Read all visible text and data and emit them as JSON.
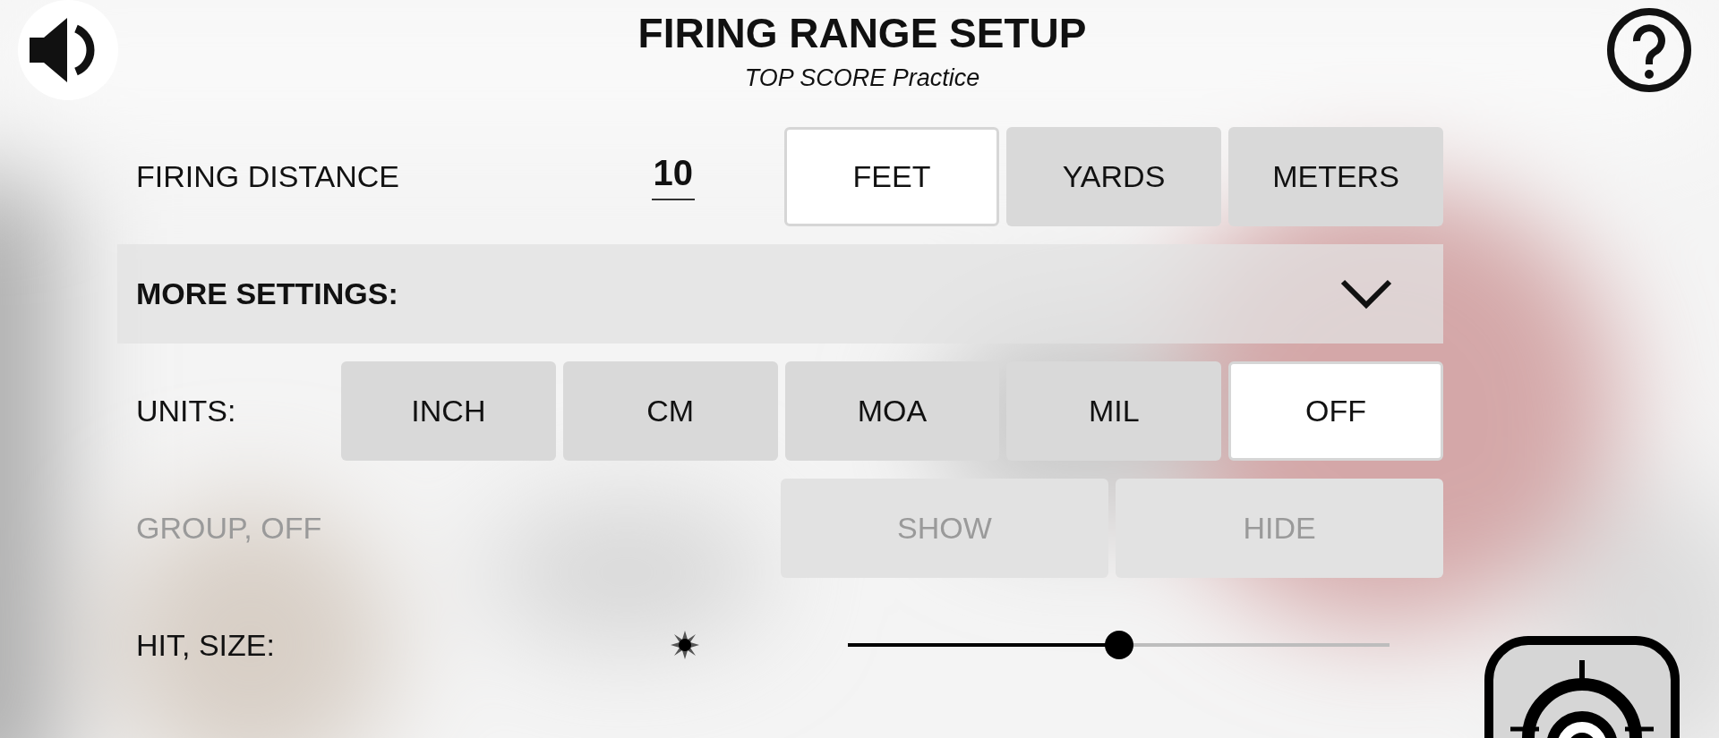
{
  "header": {
    "title": "FIRING RANGE SETUP",
    "subtitle": "TOP SCORE Practice"
  },
  "firing_distance": {
    "label": "FIRING DISTANCE",
    "value": "10",
    "units": [
      {
        "label": "FEET",
        "selected": true
      },
      {
        "label": "YARDS",
        "selected": false
      },
      {
        "label": "METERS",
        "selected": false
      }
    ]
  },
  "more_settings": {
    "label": "MORE SETTINGS:",
    "expanded": true
  },
  "units": {
    "label": "UNITS:",
    "options": [
      {
        "label": "INCH",
        "selected": false
      },
      {
        "label": "CM",
        "selected": false
      },
      {
        "label": "MOA",
        "selected": false
      },
      {
        "label": "MIL",
        "selected": false
      },
      {
        "label": "OFF",
        "selected": true
      }
    ]
  },
  "group": {
    "label": "GROUP, OFF",
    "disabled": true,
    "options": [
      {
        "label": "SHOW",
        "selected": false
      },
      {
        "label": "HIDE",
        "selected": false
      }
    ]
  },
  "hit_size": {
    "label": "HIT, SIZE:",
    "level": 0.5
  }
}
